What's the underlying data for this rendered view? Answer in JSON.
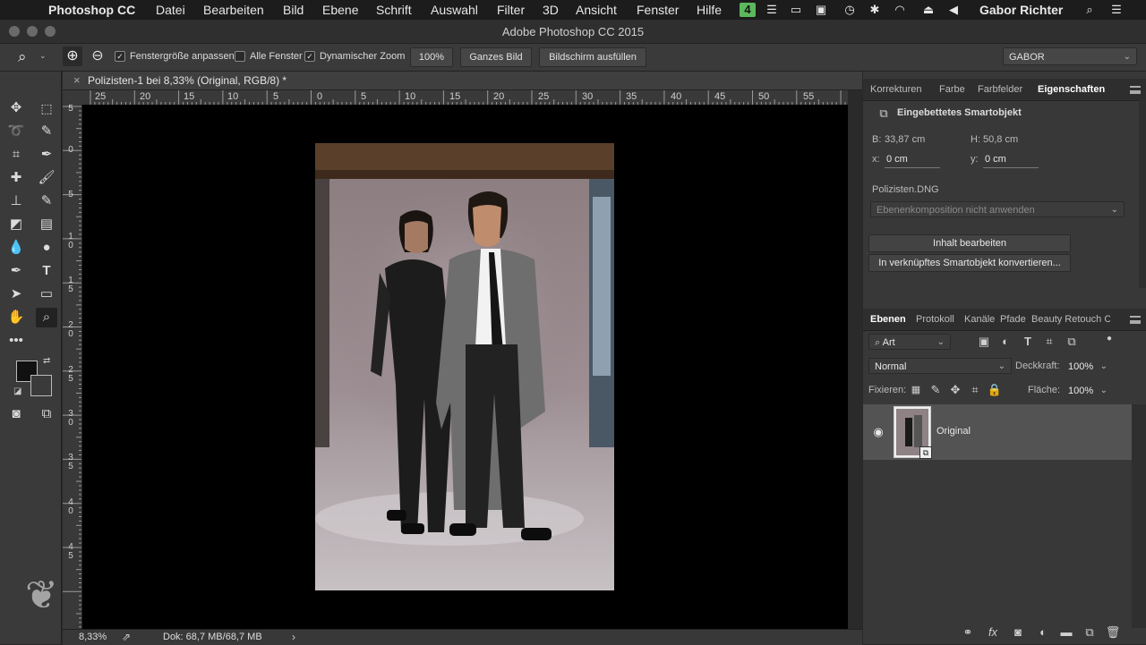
{
  "menubar": {
    "app": "Photoshop CC",
    "items": [
      "Datei",
      "Bearbeiten",
      "Bild",
      "Ebene",
      "Schrift",
      "Auswahl",
      "Filter",
      "3D",
      "Ansicht",
      "Fenster",
      "Hilfe"
    ],
    "user": "Gabor Richter"
  },
  "window": {
    "title": "Adobe Photoshop CC 2015"
  },
  "options": {
    "fit_window": "Fenstergröße anpassen",
    "all_windows": "Alle Fenster",
    "dynamic_zoom": "Dynamischer Zoom",
    "zoom_value": "100%",
    "whole_image": "Ganzes Bild",
    "fill_screen": "Bildschirm ausfüllen",
    "workspace": "GABOR"
  },
  "document": {
    "close": "×",
    "tab_title": "Polizisten-1 bei 8,33% (Original, RGB/8) *",
    "ruler_h": [
      "25",
      "20",
      "15",
      "10",
      "5",
      "0",
      "5",
      "10",
      "15",
      "20",
      "25",
      "30",
      "35",
      "40",
      "45",
      "50",
      "55"
    ],
    "ruler_v": [
      "5",
      "0",
      "5",
      "1 0",
      "1 5",
      "2 0",
      "2 5",
      "3 0",
      "3 5",
      "4 0",
      "4 5"
    ]
  },
  "status": {
    "zoom": "8,33%",
    "doc": "Dok: 68,7 MB/68,7 MB"
  },
  "properties": {
    "tabs": [
      "Korrekturen",
      "Farbe",
      "Farbfelder",
      "Eigenschaften"
    ],
    "active_tab": "Eigenschaften",
    "header": "Eingebettetes Smartobjekt",
    "w_label": "B:",
    "w_value": "33,87 cm",
    "h_label": "H:",
    "h_value": "50,8 cm",
    "x_label": "x:",
    "x_value": "0 cm",
    "y_label": "y:",
    "y_value": "0 cm",
    "file": "Polizisten.DNG",
    "comp": "Ebenenkomposition nicht anwenden",
    "edit_button": "Inhalt bearbeiten",
    "convert_button": "In verknüpftes Smartobjekt konvertieren..."
  },
  "layers": {
    "tabs": [
      "Ebenen",
      "Protokoll",
      "Kanäle",
      "Pfade",
      "Beauty Retouch C"
    ],
    "active_tab": "Ebenen",
    "filter": "Art",
    "blend_mode": "Normal",
    "opacity_label": "Deckkraft:",
    "opacity": "100%",
    "lock_label": "Fixieren:",
    "fill_label": "Fläche:",
    "fill": "100%",
    "layer_name": "Original"
  },
  "colors": {
    "accent_menu_icon": "#5cb85c"
  }
}
